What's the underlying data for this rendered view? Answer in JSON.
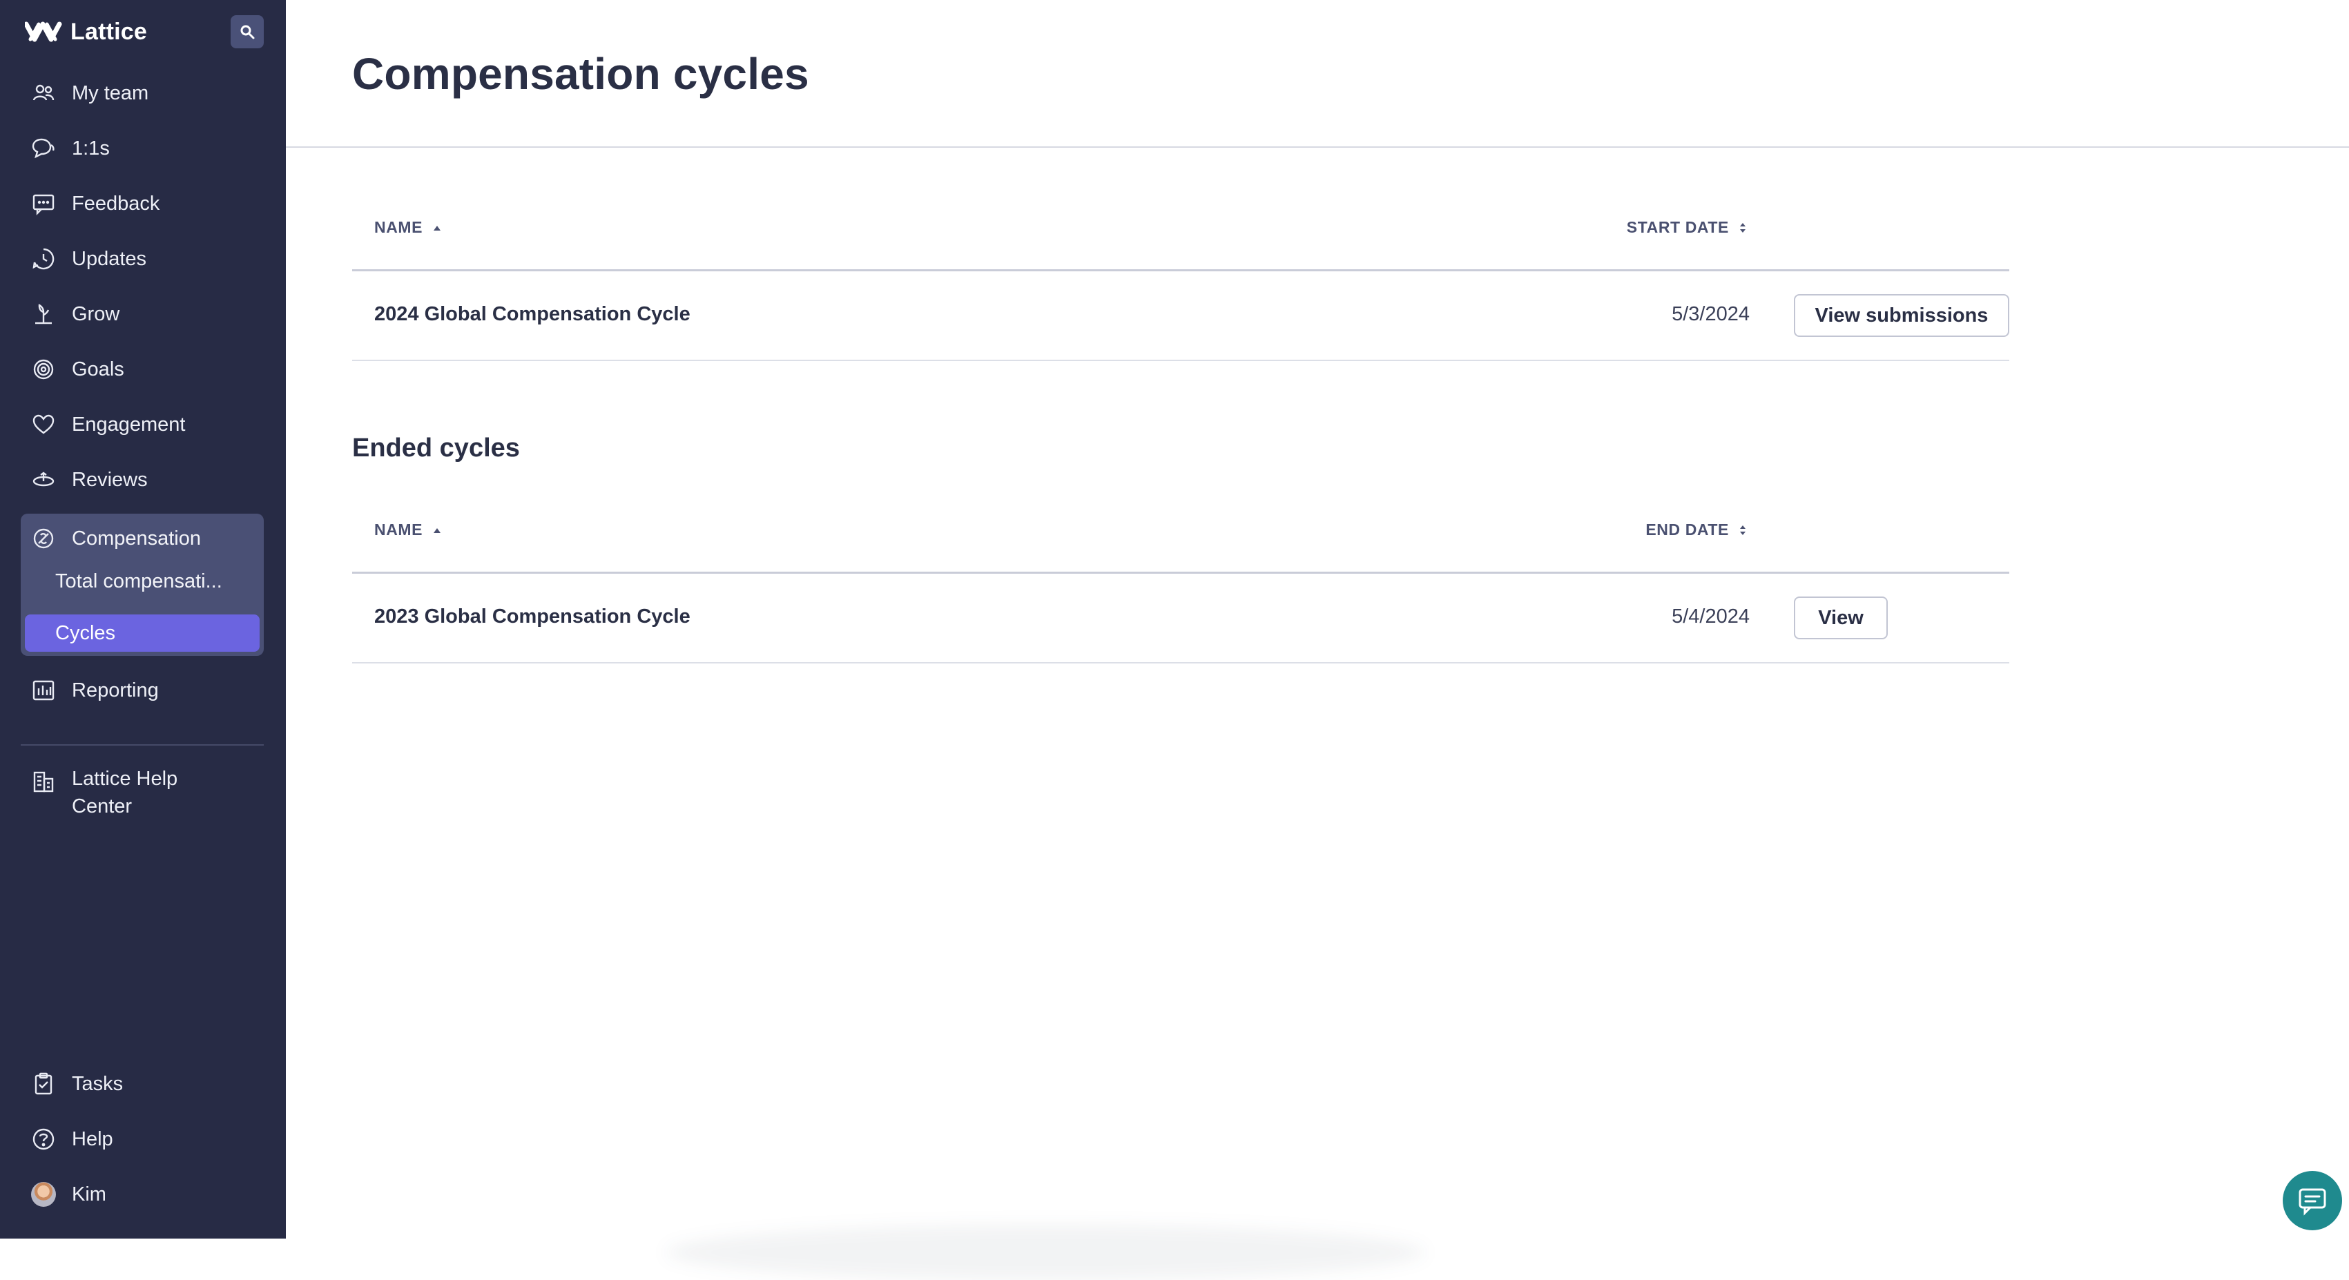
{
  "app": {
    "brand": "Lattice"
  },
  "sidebar": {
    "items": [
      {
        "label": "My team",
        "icon": "people-icon"
      },
      {
        "label": "1:1s",
        "icon": "chat-bubbles-icon"
      },
      {
        "label": "Feedback",
        "icon": "message-square-icon"
      },
      {
        "label": "Updates",
        "icon": "updates-clock-icon"
      },
      {
        "label": "Grow",
        "icon": "plant-icon"
      },
      {
        "label": "Goals",
        "icon": "target-icon"
      },
      {
        "label": "Engagement",
        "icon": "heart-icon"
      },
      {
        "label": "Reviews",
        "icon": "reviews-icon"
      }
    ],
    "compensation": {
      "label": "Compensation",
      "children": [
        {
          "label": "Total compensati..."
        },
        {
          "label": "Cycles",
          "active": true
        }
      ]
    },
    "reporting": "Reporting",
    "help_center": [
      "Lattice Help",
      "Center"
    ],
    "bottom": {
      "tasks": "Tasks",
      "help": "Help",
      "user": "Kim"
    }
  },
  "main": {
    "title": "Compensation cycles",
    "active_table": {
      "col_name": "NAME",
      "col_date": "START DATE",
      "rows": [
        {
          "name": "2024 Global Compensation Cycle",
          "date": "5/3/2024",
          "action": "View submissions"
        }
      ]
    },
    "ended_section": {
      "title": "Ended cycles",
      "col_name": "NAME",
      "col_date": "END DATE",
      "rows": [
        {
          "name": "2023 Global Compensation Cycle",
          "date": "5/4/2024",
          "action": "View"
        }
      ]
    }
  },
  "colors": {
    "sidebar_bg": "#272b45",
    "active_item": "#6b64e0",
    "group_bg": "#4a5075",
    "chat_bubble": "#1f8a8e"
  }
}
